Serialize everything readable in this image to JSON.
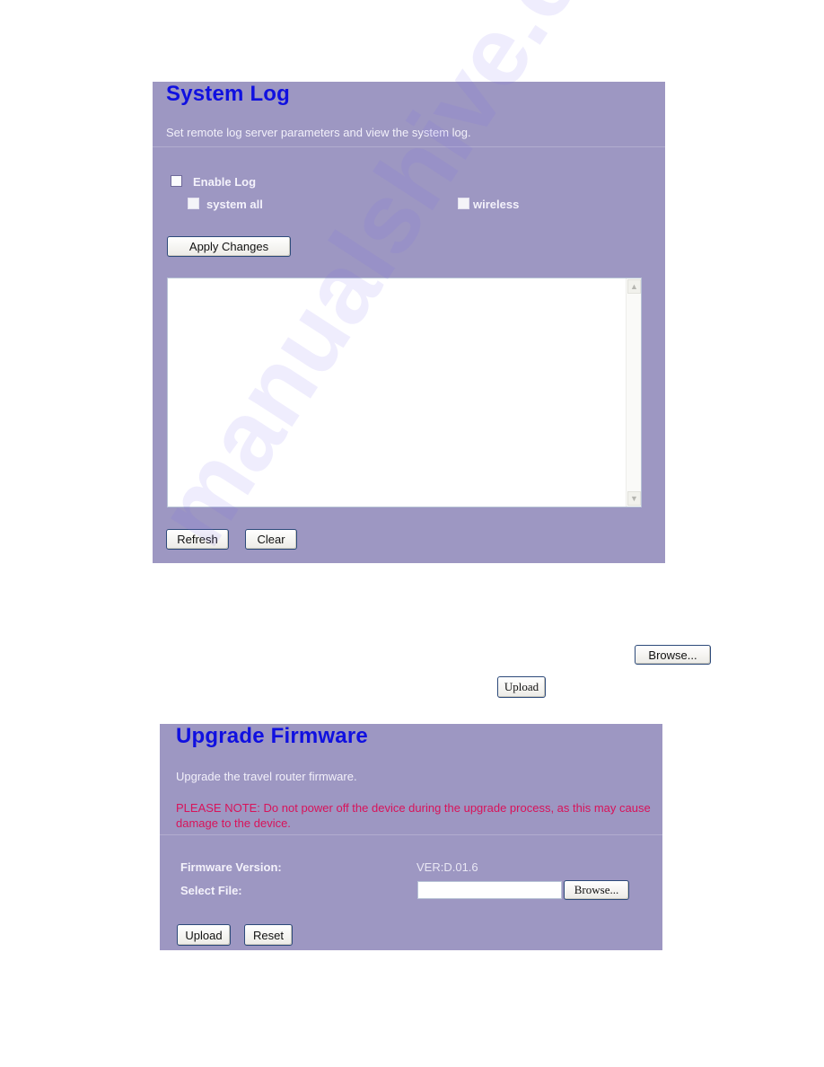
{
  "system_log": {
    "title": "System Log",
    "description": "Set remote log server parameters and view the system log.",
    "enable_log": {
      "label": "Enable Log",
      "checked": false
    },
    "options": [
      {
        "label": "system all",
        "checked": false
      },
      {
        "label": "wireless",
        "checked": false
      }
    ],
    "apply_button": "Apply Changes",
    "log_content": "",
    "refresh_button": "Refresh",
    "clear_button": "Clear"
  },
  "instructions": {
    "browse_button": "Browse...",
    "upload_button": "Upload"
  },
  "upgrade_firmware": {
    "title": "Upgrade Firmware",
    "description": "Upgrade the travel router firmware.",
    "note": "PLEASE NOTE: Do not power off the device during the upgrade process, as this may cause damage to the device.",
    "firmware_version_label": "Firmware Version:",
    "firmware_version_value": "VER:D.01.6",
    "select_file_label": "Select File:",
    "select_file_value": "",
    "browse_button": "Browse...",
    "upload_button": "Upload",
    "reset_button": "Reset"
  },
  "watermark": "manualshive.com",
  "colors": {
    "panel_bg": "#9d97c2",
    "title": "#1010e0",
    "note": "#d8135a"
  }
}
